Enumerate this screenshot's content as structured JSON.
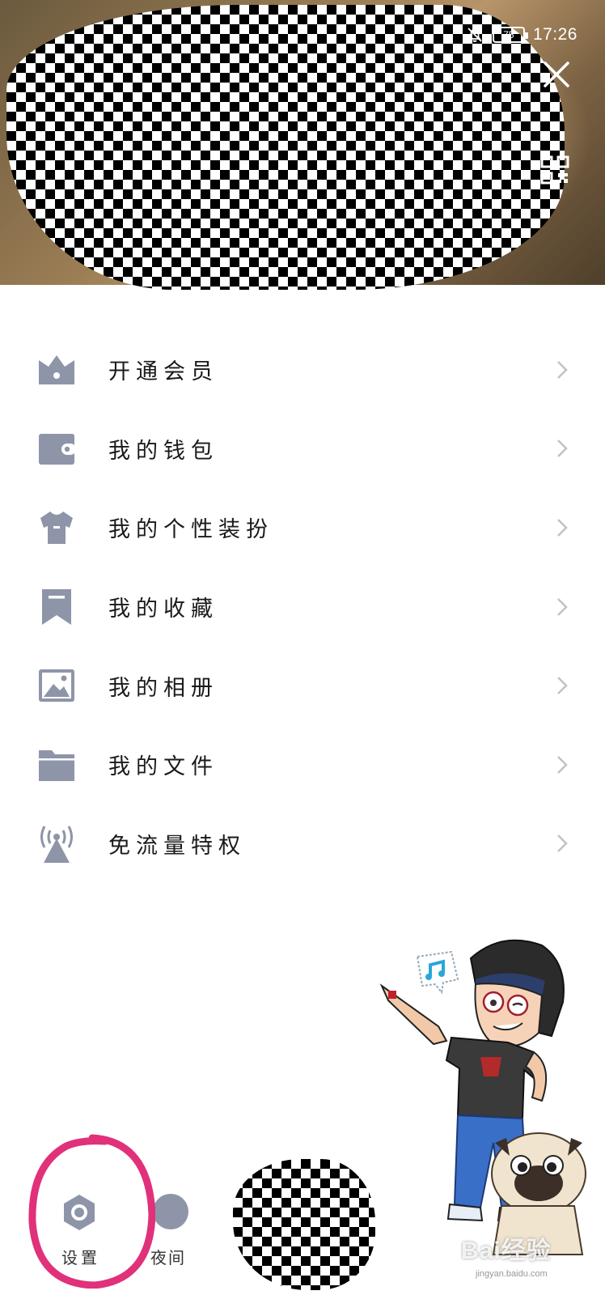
{
  "status_bar": {
    "battery": "75",
    "time": "17:26"
  },
  "menu": {
    "items": [
      {
        "label": "开通会员",
        "icon": "crown-icon"
      },
      {
        "label": "我的钱包",
        "icon": "wallet-icon"
      },
      {
        "label": "我的个性装扮",
        "icon": "tshirt-icon"
      },
      {
        "label": "我的收藏",
        "icon": "bookmark-icon"
      },
      {
        "label": "我的相册",
        "icon": "image-icon"
      },
      {
        "label": "我的文件",
        "icon": "folder-icon"
      },
      {
        "label": "免流量特权",
        "icon": "antenna-icon"
      }
    ]
  },
  "bottom_bar": {
    "settings_label": "设置",
    "night_label": "夜间"
  },
  "watermark": {
    "main": "Bai经验",
    "sub": "jingyan.baidu.com"
  },
  "colors": {
    "icon_gray": "#8e95a8",
    "chevron": "#c2c2c2",
    "highlight": "#e0317a"
  }
}
